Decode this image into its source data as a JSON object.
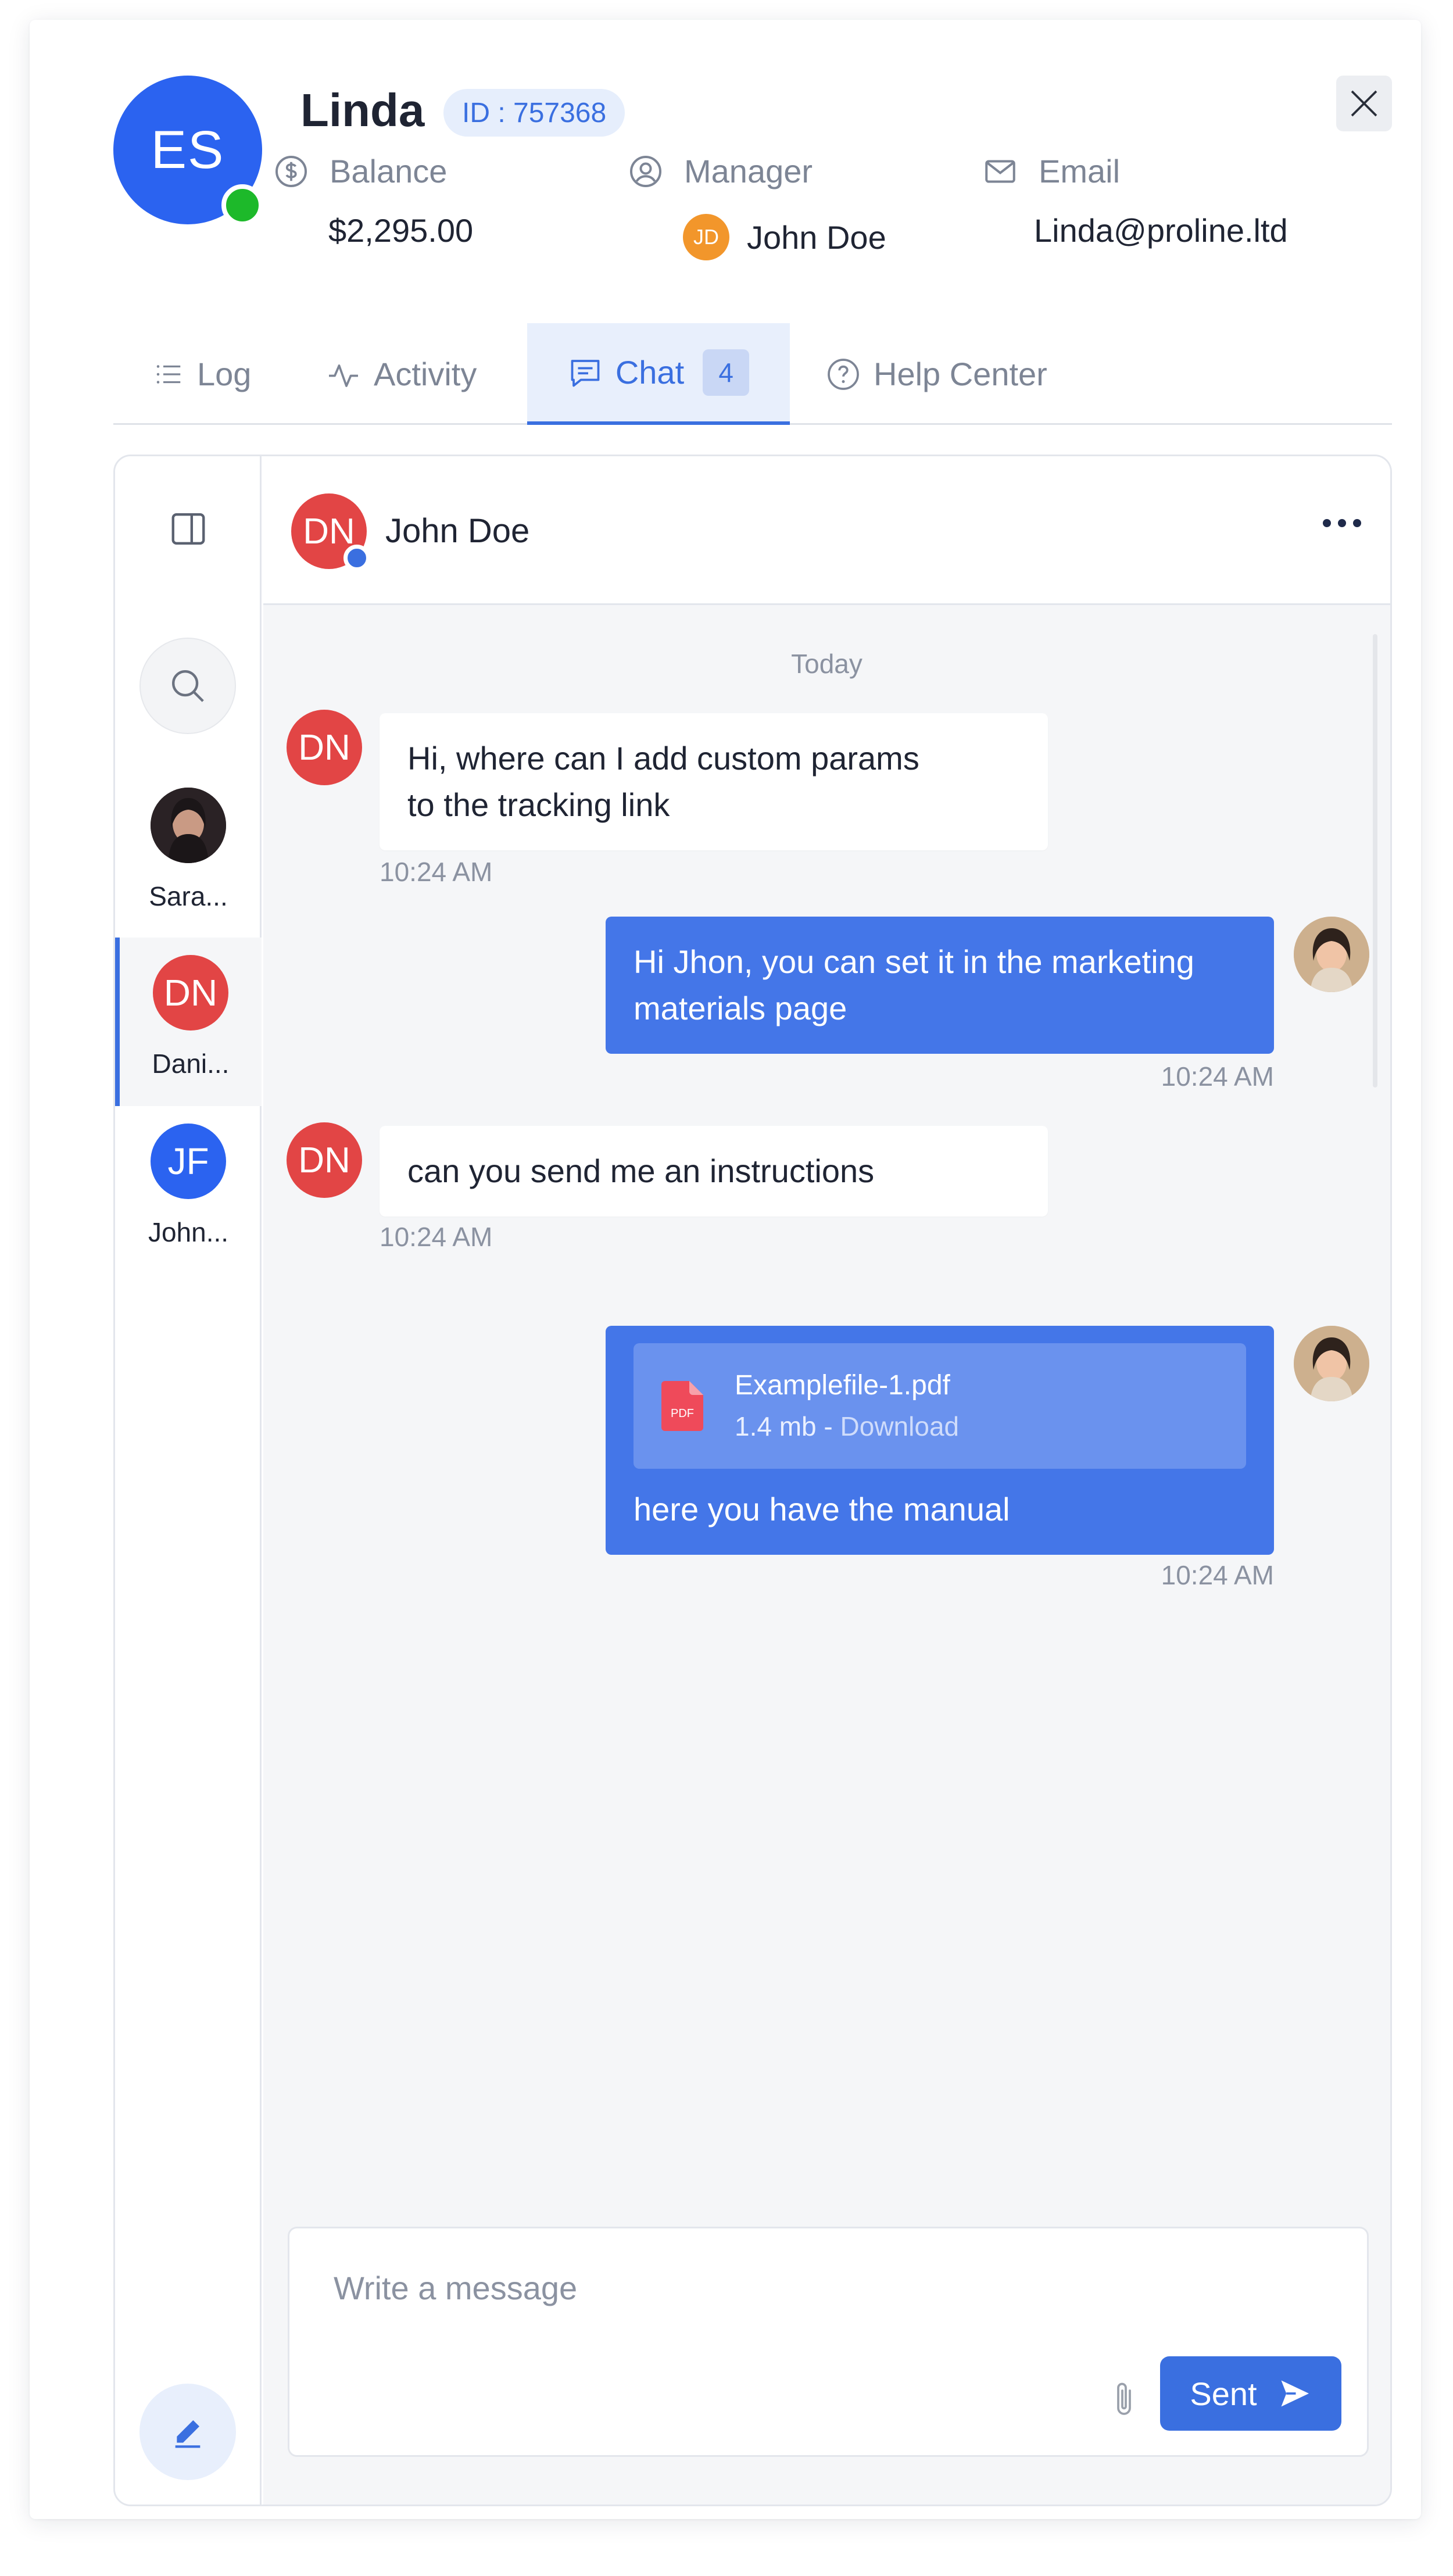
{
  "profile": {
    "initials": "ES",
    "name": "Linda",
    "id_badge": "ID : 757368",
    "balance_label": "Balance",
    "balance_value": "$2,295.00",
    "manager_label": "Manager",
    "manager_initials": "JD",
    "manager_name": "John Doe",
    "email_label": "Email",
    "email_value": "Linda@proline.ltd"
  },
  "tabs": [
    {
      "label": "Log",
      "icon": "list-icon"
    },
    {
      "label": "Activity",
      "icon": "activity-icon"
    },
    {
      "label": "Chat",
      "icon": "chat-icon",
      "count": "4",
      "active": true
    },
    {
      "label": "Help Center",
      "icon": "help-icon"
    }
  ],
  "contacts": [
    {
      "name": "Sara...",
      "avatar": "photo"
    },
    {
      "name": "Dani...",
      "initials": "DN",
      "color": "#e24545",
      "active": true
    },
    {
      "name": "John...",
      "initials": "JF",
      "color": "#2b63f0"
    }
  ],
  "conversation": {
    "initials": "DN",
    "name": "John Doe",
    "day": "Today",
    "messages": [
      {
        "direction": "in",
        "avatar": "DN",
        "text_line1": "Hi, where can I add custom params",
        "text_line2": "to the tracking link",
        "time": "10:24 AM"
      },
      {
        "direction": "out",
        "text_line1": "Hi Jhon, you can set it in the marketing",
        "text_line2": "materials page",
        "time": "10:24 AM"
      },
      {
        "direction": "in",
        "avatar": "DN",
        "text_line1": "can you send me an instructions",
        "time": "10:24 AM"
      },
      {
        "direction": "out",
        "file_name": "Examplefile-1.pdf",
        "file_size": "1.4 mb",
        "file_sep": " - ",
        "file_action": "Download",
        "file_type": "PDF",
        "text_line1": "here you have the manual",
        "time": "10:24 AM"
      }
    ]
  },
  "composer": {
    "placeholder": "Write a message",
    "send_label": "Sent"
  },
  "colors": {
    "accent": "#3a6fe0",
    "online": "#1db92a",
    "dn_red": "#e24545",
    "manager_orange": "#f2962b"
  }
}
